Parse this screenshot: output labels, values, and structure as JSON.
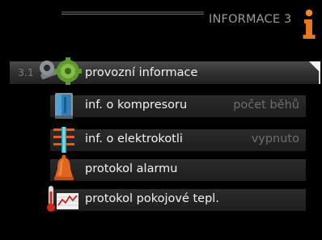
{
  "header": {
    "title": "INFORMACE 3",
    "info_icon": "info-icon",
    "accent_color": "#e8761c"
  },
  "menu": {
    "items": [
      {
        "index": "3.1",
        "label": "provozní informace",
        "value": "",
        "icon": "gear-wrench-icon",
        "selected": true
      },
      {
        "label": "inf. o kompresoru",
        "value": "počet běhů",
        "icon": "compressor-icon"
      },
      {
        "label": "inf. o elektrokotli",
        "value": "vypnuto",
        "icon": "heater-icon"
      },
      {
        "label": "protokol alarmu",
        "value": "",
        "icon": "alarm-bell-icon"
      },
      {
        "label": "protokol pokojové tepl.",
        "value": "",
        "icon": "thermometer-chart-icon"
      }
    ]
  }
}
